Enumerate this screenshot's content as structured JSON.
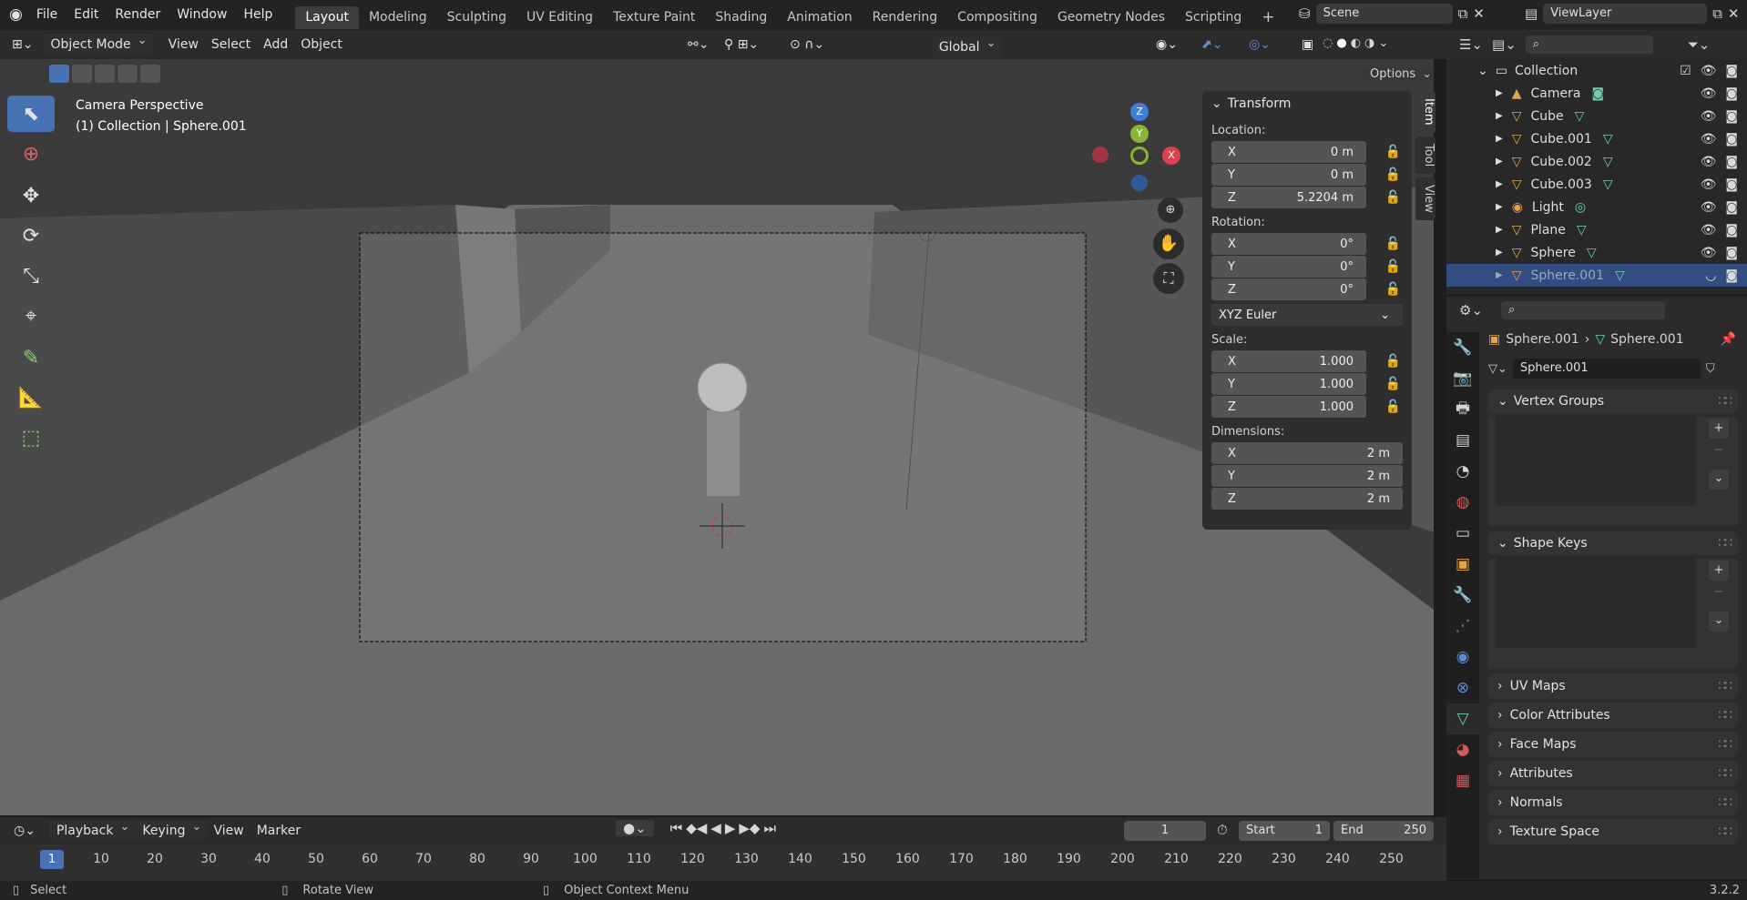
{
  "topbar": {
    "menu": [
      "File",
      "Edit",
      "Render",
      "Window",
      "Help"
    ],
    "workspaces": [
      "Layout",
      "Modeling",
      "Sculpting",
      "UV Editing",
      "Texture Paint",
      "Shading",
      "Animation",
      "Rendering",
      "Compositing",
      "Geometry Nodes",
      "Scripting"
    ],
    "active_workspace": "Layout",
    "scene": "Scene",
    "view_layer": "ViewLayer"
  },
  "viewport_header": {
    "mode": "Object Mode",
    "menus": [
      "View",
      "Select",
      "Add",
      "Object"
    ],
    "orientation": "Global",
    "options": "Options"
  },
  "viewport": {
    "title": "Camera Perspective",
    "subtitle": "(1) Collection | Sphere.001",
    "gizmo_axes": [
      "Z",
      "Y",
      "X"
    ]
  },
  "npanel": {
    "header": "Transform",
    "location_label": "Location:",
    "location": [
      {
        "axis": "X",
        "value": "0 m"
      },
      {
        "axis": "Y",
        "value": "0 m"
      },
      {
        "axis": "Z",
        "value": "5.2204 m"
      }
    ],
    "rotation_label": "Rotation:",
    "rotation": [
      {
        "axis": "X",
        "value": "0°"
      },
      {
        "axis": "Y",
        "value": "0°"
      },
      {
        "axis": "Z",
        "value": "0°"
      }
    ],
    "rotation_mode": "XYZ Euler",
    "scale_label": "Scale:",
    "scale": [
      {
        "axis": "X",
        "value": "1.000"
      },
      {
        "axis": "Y",
        "value": "1.000"
      },
      {
        "axis": "Z",
        "value": "1.000"
      }
    ],
    "dimensions_label": "Dimensions:",
    "dimensions": [
      {
        "axis": "X",
        "value": "2 m"
      },
      {
        "axis": "Y",
        "value": "2 m"
      },
      {
        "axis": "Z",
        "value": "2 m"
      }
    ],
    "tabs": [
      "Item",
      "Tool",
      "View"
    ]
  },
  "outliner": {
    "collection": "Collection",
    "items": [
      "Camera",
      "Cube",
      "Cube.001",
      "Cube.002",
      "Cube.003",
      "Light",
      "Plane",
      "Sphere",
      "Sphere.001"
    ],
    "selected": "Sphere.001"
  },
  "properties": {
    "breadcrumb_object": "Sphere.001",
    "breadcrumb_data": "Sphere.001",
    "mesh_name": "Sphere.001",
    "panels": [
      "Vertex Groups",
      "Shape Keys",
      "UV Maps",
      "Color Attributes",
      "Face Maps",
      "Attributes",
      "Normals",
      "Texture Space"
    ]
  },
  "timeline": {
    "menus": [
      "Playback",
      "Keying",
      "View",
      "Marker"
    ],
    "current_frame": "1",
    "start_label": "Start",
    "start": "1",
    "end_label": "End",
    "end": "250",
    "ticks": [
      "1",
      "10",
      "20",
      "30",
      "40",
      "50",
      "60",
      "70",
      "80",
      "90",
      "100",
      "110",
      "120",
      "130",
      "140",
      "150",
      "160",
      "170",
      "180",
      "190",
      "200",
      "210",
      "220",
      "230",
      "240",
      "250"
    ]
  },
  "statusbar": {
    "select": "Select",
    "rotate": "Rotate View",
    "context": "Object Context Menu",
    "version": "3.2.2"
  },
  "colors": {
    "accent": "#4772b3",
    "selected_row": "#334d80",
    "x_axis": "#e04050",
    "y_axis": "#8ab436",
    "z_axis": "#3f7fd6"
  }
}
